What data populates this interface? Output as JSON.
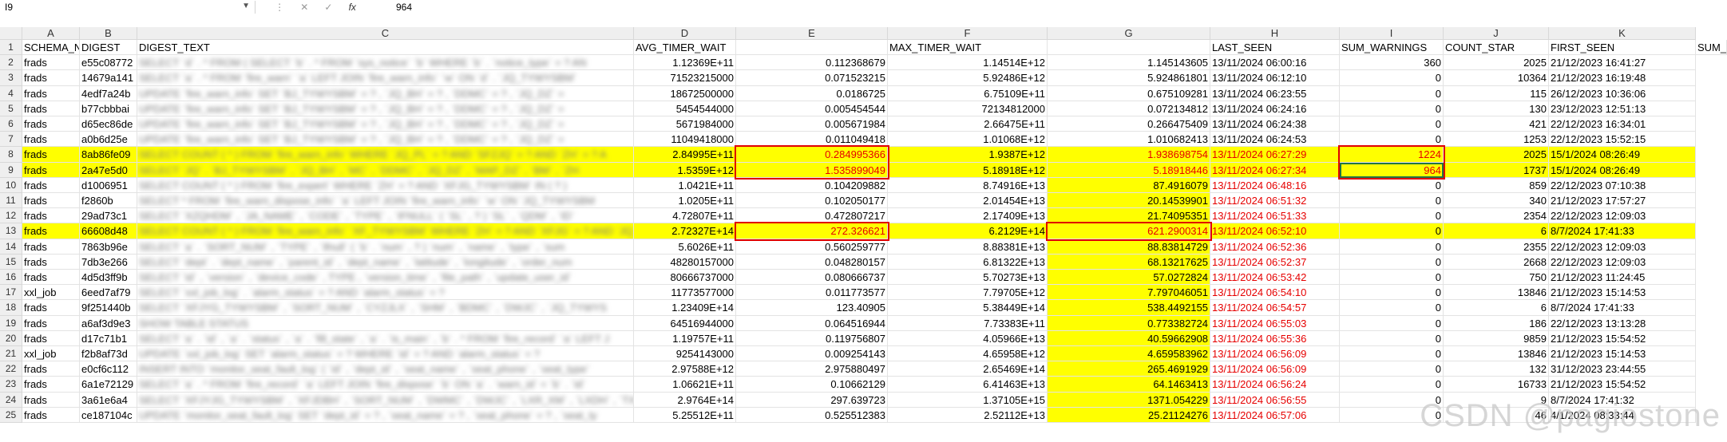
{
  "formula_bar": {
    "name_box": "I9",
    "formula_value": "964",
    "icons": [
      "more-icon",
      "cancel-icon",
      "confirm-icon",
      "function-icon"
    ],
    "fx_label": "fx"
  },
  "columns": [
    "A",
    "B",
    "C",
    "D",
    "E",
    "F",
    "G",
    "H",
    "I",
    "J",
    "K"
  ],
  "rows": [
    {
      "num": "1",
      "a": "SCHEMA_NA",
      "b": "DIGEST",
      "c": "DIGEST_TEXT",
      "d": "AVG_TIMER_WAIT",
      "e": "",
      "f": "MAX_TIMER_WAIT",
      "g": "",
      "h": "LAST_SEEN",
      "i": "SUM_WARNINGS",
      "j": "COUNT_STAR",
      "k": "FIRST_SEEN",
      "l": "SUM_"
    },
    {
      "num": "2",
      "a": "frads",
      "b": "e55c08772",
      "c": "SELECT `d` . * FROM ( SELECT `b` . * FROM `sys_notice` `b` WHERE `b` . `notice_type` = ? AN",
      "d": "1.12369E+11",
      "e": "0.112368679",
      "f": "1.14514E+12",
      "g": "1.145143605",
      "h": "13/11/2024 06:00:16",
      "i": "360",
      "j": "2025",
      "k": "21/12/2023 16:41:27"
    },
    {
      "num": "3",
      "a": "frads",
      "b": "14679a141",
      "c": "SELECT `a` . * FROM `fire_warn` `a` LEFT JOIN `fire_warn_info` `w` ON `d` . `JQ_TYWYSBM`",
      "d": "71523215000",
      "e": "0.071523215",
      "f": "5.92486E+12",
      "g": "5.924861801",
      "h": "13/11/2024 06:12:10",
      "i": "0",
      "j": "10364",
      "k": "21/12/2023 16:19:48"
    },
    {
      "num": "4",
      "a": "frads",
      "b": "4edf7a24b",
      "c": "UPDATE `fire_warn_info` SET `BJ_TYWYSBM` = ? , `JQ_BH` = ? , `DDMC` = ? , `JQ_DZ` =",
      "d": "18672500000",
      "e": "0.0186725",
      "f": "6.75109E+11",
      "g": "0.675109281",
      "h": "13/11/2024 06:23:55",
      "i": "0",
      "j": "115",
      "k": "26/12/2023 10:36:06"
    },
    {
      "num": "5",
      "a": "frads",
      "b": "b77cbbbai",
      "c": "UPDATE `fire_warn_info` SET `BJ_TYWYSBM` = ? , `JQ_BH` = ? , `DDMC` = ? , `JQ_DZ` =",
      "d": "5454544000",
      "e": "0.005454544",
      "f": "72134812000",
      "g": "0.072134812",
      "h": "13/11/2024 06:24:16",
      "i": "0",
      "j": "130",
      "k": "23/12/2023 12:51:13"
    },
    {
      "num": "6",
      "a": "frads",
      "b": "d65ec86de",
      "c": "UPDATE `fire_warn_info` SET `BJ_TYWYSBM` = ? , `JQ_BH` = ? , `DDMC` = ? , `JQ_DZ` =",
      "d": "5671984000",
      "e": "0.005671984",
      "f": "2.66475E+11",
      "g": "0.266475409",
      "h": "13/11/2024 06:24:38",
      "i": "0",
      "j": "421",
      "k": "22/12/2023 16:34:01"
    },
    {
      "num": "7",
      "a": "frads",
      "b": "a0b6d25e",
      "c": "UPDATE `fire_warn_info` SET `BJ_TYWYSBM` = ? , `JQ_BH` = ? , `DDMC` = ? , `JQ_DZ` =",
      "d": "11049418000",
      "e": "0.011049418",
      "f": "1.01068E+12",
      "g": "1.010682413",
      "h": "13/11/2024 06:24:53",
      "i": "0",
      "j": "1253",
      "k": "22/12/2023 15:52:15"
    },
    {
      "num": "8",
      "a": "frads",
      "b": "8ab86fe09",
      "c": "SELECT COUNT ( * ) FROM `fire_warn_info` WHERE `JQ_PL` = ? AND `SFZJQ` = ? AND `ZH` = ? A",
      "d": "2.84995E+11",
      "e": "0.284995366",
      "f": "1.9387E+12",
      "g": "1.938698754",
      "h": "13/11/2024 06:27:29",
      "i": "1224",
      "j": "2025",
      "k": "15/1/2024 08:26:49"
    },
    {
      "num": "9",
      "a": "frads",
      "b": "2a47e5d0",
      "c": "SELECT `JQ` . `BJ_TYWYSBM` , `JQ_BH` , `MC` , `DDMC` , `JQ_DZ` , `MAP_DZ` , `BM` , `ZH",
      "d": "1.5359E+12",
      "e": "1.535899049",
      "f": "5.18918E+12",
      "g": "5.18918446",
      "h": "13/11/2024 06:27:34",
      "i": "964",
      "j": "1737",
      "k": "15/1/2024 08:26:49"
    },
    {
      "num": "10",
      "a": "frads",
      "b": "d1006951",
      "c": "SELECT COUNT ( * ) FROM `fire_expert` WHERE `ZH` = ? AND `XFJG_TYWYSBM` IN ( ? )",
      "d": "1.0421E+11",
      "e": "0.104209882",
      "f": "8.74916E+13",
      "g": "87.4916079",
      "h": "13/11/2024 06:48:16",
      "i": "0",
      "j": "859",
      "k": "22/12/2023 07:10:38"
    },
    {
      "num": "11",
      "a": "frads",
      "b": "f2860b",
      "c": "SELECT * FROM `fire_warn_dispose_info` `a` LEFT JOIN `fire_warn_info` `w` ON `JQ_TYWYSBM",
      "d": "1.0205E+11",
      "e": "0.102050177",
      "f": "2.01454E+13",
      "g": "20.14539901",
      "h": "13/11/2024 06:51:32",
      "i": "0",
      "j": "340",
      "k": "21/12/2023 17:57:27"
    },
    {
      "num": "12",
      "a": "frads",
      "b": "29ad73c1",
      "c": "SELECT `XZQHDM` , `JA_NAME` , `CODE` , `TYPE` , `IFNULL` ( `SL` , ? ) `SL` , `QDM` , `ID`",
      "d": "4.72807E+11",
      "e": "0.472807217",
      "f": "2.17409E+13",
      "g": "21.74095351",
      "h": "13/11/2024 06:51:33",
      "i": "0",
      "j": "2354",
      "k": "22/12/2023 12:09:03"
    },
    {
      "num": "13",
      "a": "frads",
      "b": "66608d48",
      "c": "SELECT COUNT ( * ) FROM `fire_warn_info` `XF_TYWYSBM` WHERE `ZH` = ? AND `XFJG` = ? AND `JQ_XFJG_TYWYSBM`",
      "d": "2.72327E+14",
      "e": "272.326621",
      "f": "6.2129E+14",
      "g": "621.2900314",
      "h": "13/11/2024 06:52:10",
      "i": "0",
      "j": "6",
      "k": "8/7/2024 17:41:33"
    },
    {
      "num": "14",
      "a": "frads",
      "b": "7863b96e",
      "c": "SELECT `a` . `SORT_NUM` , `TYPE` , `ifnull` ( `b` . `num` , ? ) `num` , `name` , `type` , `sum",
      "d": "5.6026E+11",
      "e": "0.560259777",
      "f": "8.88381E+13",
      "g": "88.83814729",
      "h": "13/11/2024 06:52:36",
      "i": "0",
      "j": "2355",
      "k": "22/12/2023 12:09:03"
    },
    {
      "num": "15",
      "a": "frads",
      "b": "7db3e266",
      "c": "SELECT `dept` . `dept_name` , `parent_id` , `dept_name` , `latitude` , `longitude` , `order_num",
      "d": "48280157000",
      "e": "0.048280157",
      "f": "6.81322E+13",
      "g": "68.13217625",
      "h": "13/11/2024 06:52:37",
      "i": "0",
      "j": "2668",
      "k": "22/12/2023 12:09:03"
    },
    {
      "num": "16",
      "a": "frads",
      "b": "4d5d3ff9b",
      "c": "SELECT `id` , `version` , `device_code` , TYPE , `version_time` , `file_path` , `update_user_id`",
      "d": "80666737000",
      "e": "0.080666737",
      "f": "5.70273E+13",
      "g": "57.0272824",
      "h": "13/11/2024 06:53:42",
      "i": "0",
      "j": "750",
      "k": "21/12/2023 11:24:45"
    },
    {
      "num": "17",
      "a": "xxl_job",
      "b": "6eed7af79",
      "c": "SELECT `xxl_job_log` . `alarm_status` = ? AND `alarm_status` = ?",
      "d": "11773577000",
      "e": "0.011773577",
      "f": "7.79705E+12",
      "g": "7.797046051",
      "h": "13/11/2024 06:54:10",
      "i": "0",
      "j": "13846",
      "k": "21/12/2023 15:14:53"
    },
    {
      "num": "18",
      "a": "frads",
      "b": "9f251440b",
      "c": "SELECT `XFJYG_TYWYSBM` , `SORT_NUM` , `CYZJLX` , `SHM` , `BDMC` , `DWJC` , `JQ_TYWYS",
      "d": "1.23409E+14",
      "e": "123.40905",
      "f": "5.38449E+14",
      "g": "538.4492155",
      "h": "13/11/2024 06:54:57",
      "i": "0",
      "j": "6",
      "k": "8/7/2024 17:41:33"
    },
    {
      "num": "19",
      "a": "frads",
      "b": "a6af3d9e3",
      "c": "SHOW TABLE STATUS",
      "d": "64516944000",
      "e": "0.064516944",
      "f": "7.73383E+11",
      "g": "0.773382724",
      "h": "13/11/2024 06:55:03",
      "i": "0",
      "j": "186",
      "k": "22/12/2023 13:13:28"
    },
    {
      "num": "20",
      "a": "frads",
      "b": "d17c71b1",
      "c": "SELECT `a` . `id` , `a` . `status` , `a` . `fill_state` , `a` . `is_main` , `b` . * FROM `fire_record` `a` LEFT J",
      "d": "1.19757E+11",
      "e": "0.119756807",
      "f": "4.05966E+13",
      "g": "40.59662908",
      "h": "13/11/2024 06:55:36",
      "i": "0",
      "j": "9859",
      "k": "21/12/2023 15:54:52"
    },
    {
      "num": "21",
      "a": "xxl_job",
      "b": "f2b8af73d",
      "c": "UPDATE `xxl_job_log` SET `alarm_status` = ? WHERE `id` = ? AND `alarm_status` = ?",
      "d": "9254143000",
      "e": "0.009254143",
      "f": "4.65958E+12",
      "g": "4.659583962",
      "h": "13/11/2024 06:56:09",
      "i": "0",
      "j": "13846",
      "k": "21/12/2023 15:14:53"
    },
    {
      "num": "22",
      "a": "frads",
      "b": "e0cf6c112",
      "c": "INSERT INTO `monitor_seat_fault_log` ( `id` , `dept_id` , `seat_name` , `seat_phone` , `seat_type`",
      "d": "2.97588E+12",
      "e": "2.975880497",
      "f": "2.65469E+14",
      "g": "265.4691929",
      "h": "13/11/2024 06:56:09",
      "i": "0",
      "j": "132",
      "k": "31/12/2023 23:44:55"
    },
    {
      "num": "23",
      "a": "frads",
      "b": "6a1e72129",
      "c": "SELECT `a` . * FROM `fire_record` `a` LEFT JOIN `fire_dispose` `b` ON `a` . `warn_id` = `b` . `id`",
      "d": "1.06621E+11",
      "e": "0.10662129",
      "f": "6.41463E+13",
      "g": "64.1463413",
      "h": "13/11/2024 06:56:24",
      "i": "0",
      "j": "16733",
      "k": "21/12/2023 15:54:52"
    },
    {
      "num": "24",
      "a": "frads",
      "b": "3a61e6a4",
      "c": "SELECT `XFJYJG_TYWYSBM` , `XFJDBH` , `SORT_NUM` , `DWMC` , `DWJC` , `LXR_XM` , `LXDH` , `TX",
      "d": "2.9764E+14",
      "e": "297.639723",
      "f": "1.37105E+15",
      "g": "1371.054229",
      "h": "13/11/2024 06:56:55",
      "i": "0",
      "j": "9",
      "k": "8/7/2024 17:41:32"
    },
    {
      "num": "25",
      "a": "frads",
      "b": "ce187104c",
      "c": "UPDATE `monitor_seat_fault_log` SET `dept_id` = ? , `seat_name` = ? , `seat_phone` = ? , `seat_ty",
      "d": "5.25512E+11",
      "e": "0.525512383",
      "f": "2.52112E+13",
      "g": "25.21124276",
      "h": "13/11/2024 06:57:06",
      "i": "0",
      "j": "46",
      "k": "4/1/2024 08:33:44"
    }
  ],
  "watermark": "CSDN @pagiostone"
}
